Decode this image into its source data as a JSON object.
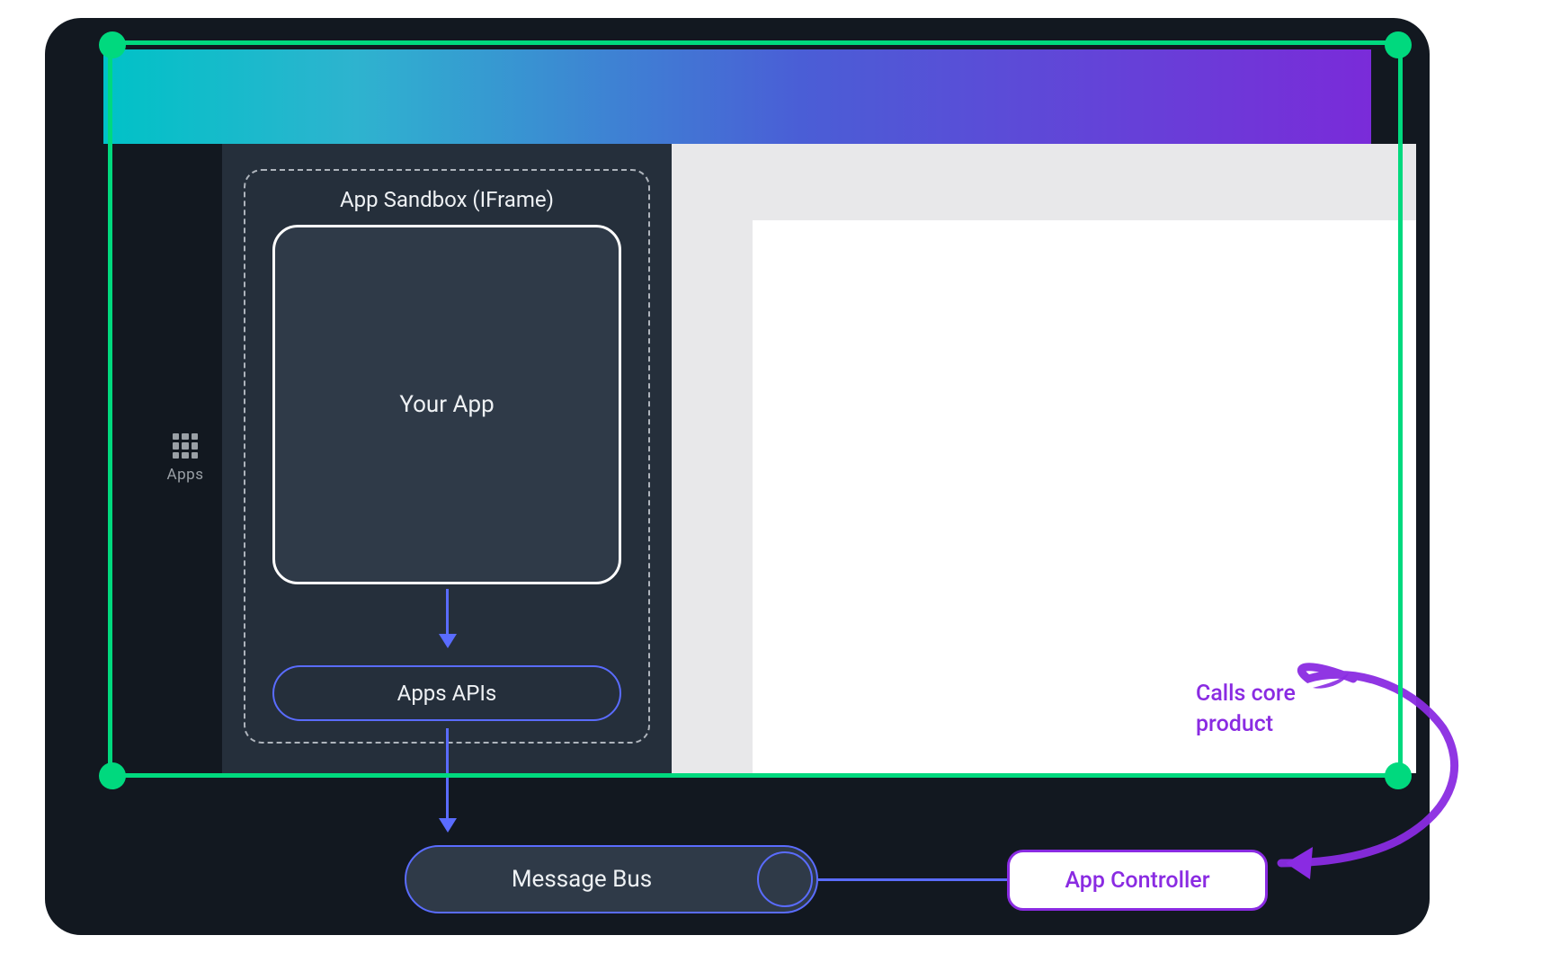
{
  "rail": {
    "apps_label": "Apps"
  },
  "sandbox": {
    "title": "App Sandbox (IFrame)",
    "your_app_label": "Your App",
    "apps_apis_label": "Apps APIs"
  },
  "bus": {
    "label": "Message Bus"
  },
  "controller": {
    "label": "App Controller"
  },
  "annotation": {
    "calls_core": "Calls core\nproduct"
  },
  "colors": {
    "green": "#00d97e",
    "blue": "#5a6cff",
    "purple": "#8a2be2",
    "panel_dark": "#252f3b",
    "panel_darkest": "#121820"
  }
}
